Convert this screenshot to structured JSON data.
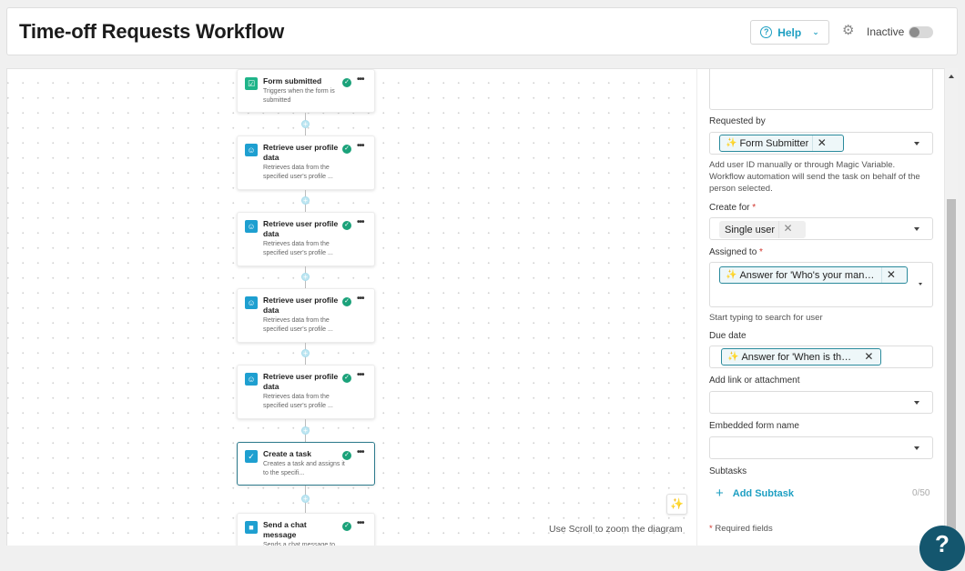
{
  "header": {
    "title": "Time-off Requests Workflow",
    "help_label": "Help",
    "help_icon": "question-circle-icon",
    "settings_icon": "gear-icon",
    "status_label": "Inactive",
    "status_active": false
  },
  "canvas": {
    "nodes": [
      {
        "title": "Form submitted",
        "description": "Triggers when the form is submitted",
        "icon": "form-icon",
        "icon_color": "#1fb489",
        "status": "complete",
        "selected": false
      },
      {
        "title": "Retrieve user profile data",
        "description": "Retrieves data from the specified user's profile ...",
        "icon": "user-icon",
        "icon_color": "#1e9fd0",
        "status": "complete",
        "selected": false
      },
      {
        "title": "Retrieve user profile data",
        "description": "Retrieves data from the specified user's profile ...",
        "icon": "user-icon",
        "icon_color": "#1e9fd0",
        "status": "complete",
        "selected": false
      },
      {
        "title": "Retrieve user profile data",
        "description": "Retrieves data from the specified user's profile ...",
        "icon": "user-icon",
        "icon_color": "#1e9fd0",
        "status": "complete",
        "selected": false
      },
      {
        "title": "Retrieve user profile data",
        "description": "Retrieves data from the specified user's profile ...",
        "icon": "user-icon",
        "icon_color": "#1e9fd0",
        "status": "complete",
        "selected": false
      },
      {
        "title": "Create a task",
        "description": "Creates a task and assigns it to the specifi...",
        "icon": "checkbox-icon",
        "icon_color": "#1e9fd0",
        "status": "complete",
        "selected": true
      },
      {
        "title": "Send a chat message",
        "description": "Sends a chat message to one or more specified...",
        "icon": "chat-icon",
        "icon_color": "#1e9fd0",
        "status": "complete",
        "selected": false
      }
    ],
    "zoom_hint": "Use Scroll to zoom the diagram",
    "magic_button_icon": "magic-wand-icon"
  },
  "panel": {
    "requested_by": {
      "label": "Requested by",
      "chip": "Form Submitter",
      "help": "Add user ID manually or through Magic Variable. Workflow automation will send the task on behalf of the person selected."
    },
    "create_for": {
      "label": "Create for",
      "required": "*",
      "chip": "Single user"
    },
    "assigned_to": {
      "label": "Assigned to",
      "required": "*",
      "chip": "Answer for 'Who's your manager?'",
      "help": "Start typing to search for user"
    },
    "due_date": {
      "label": "Due date",
      "chip": "Answer for 'When is th…"
    },
    "link_attachment": {
      "label": "Add link or attachment",
      "value": ""
    },
    "embedded_form": {
      "label": "Embedded form name",
      "value": ""
    },
    "subtasks": {
      "label": "Subtasks",
      "add_label": "Add Subtask",
      "count": "0/50"
    },
    "required_note": "Required fields",
    "required_mark": "*"
  },
  "fab": {
    "label": "?"
  },
  "colors": {
    "accent": "#1e9fc2",
    "success": "#1ba27a",
    "chip_border": "#2a8a9c",
    "fab": "#14566e"
  }
}
